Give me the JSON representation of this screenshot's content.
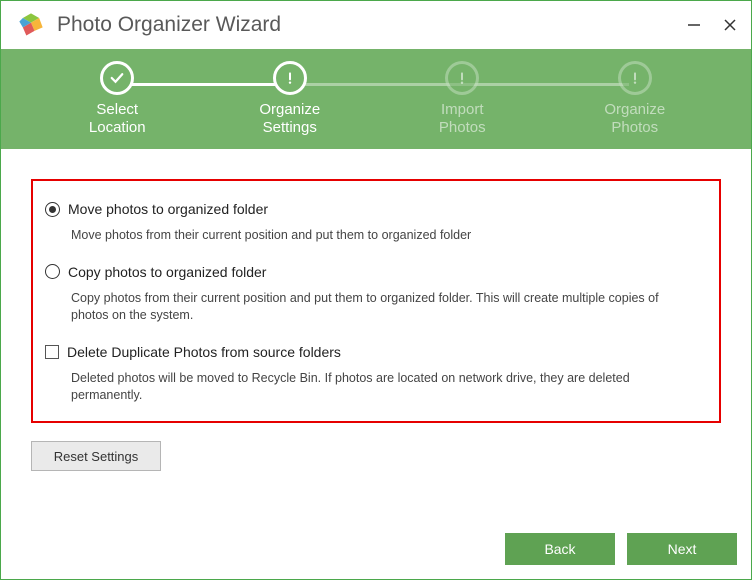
{
  "window": {
    "title": "Photo Organizer Wizard"
  },
  "steps": [
    {
      "line1": "Select",
      "line2": "Location",
      "state": "done"
    },
    {
      "line1": "Organize",
      "line2": "Settings",
      "state": "current"
    },
    {
      "line1": "Import",
      "line2": "Photos",
      "state": "pending"
    },
    {
      "line1": "Organize",
      "line2": "Photos",
      "state": "pending"
    }
  ],
  "options": {
    "move": {
      "label": "Move photos to organized folder",
      "desc": "Move photos from their current position and put them to organized folder",
      "selected": true
    },
    "copy": {
      "label": "Copy photos to organized folder",
      "desc": "Copy photos from their current position and put them to organized folder. This will create multiple copies of photos on the system.",
      "selected": false
    },
    "dedupe": {
      "label": "Delete Duplicate Photos from source folders",
      "desc": "Deleted photos will be moved to Recycle Bin. If photos are located on network drive, they are deleted permanently.",
      "checked": false
    }
  },
  "buttons": {
    "reset": "Reset Settings",
    "back": "Back",
    "next": "Next"
  }
}
